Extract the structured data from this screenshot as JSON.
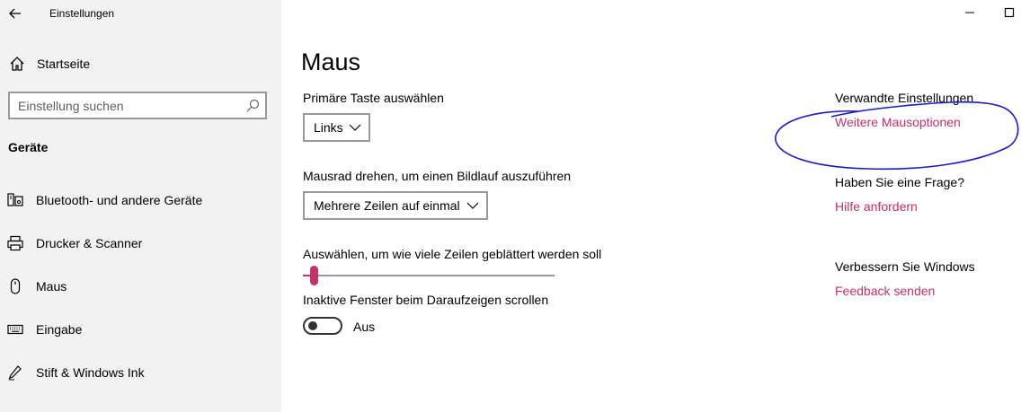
{
  "window": {
    "title": "Einstellungen",
    "back_icon": "arrow-left-icon",
    "minimize_icon": "minimize-icon",
    "maximize_icon": "maximize-icon"
  },
  "sidebar": {
    "home_label": "Startseite",
    "home_icon": "home-icon",
    "search_placeholder": "Einstellung suchen",
    "search_icon": "search-icon",
    "section_title": "Geräte",
    "items": [
      {
        "label": "Bluetooth- und andere Geräte",
        "icon": "bluetooth-devices-icon"
      },
      {
        "label": "Drucker & Scanner",
        "icon": "printer-icon"
      },
      {
        "label": "Maus",
        "icon": "mouse-icon"
      },
      {
        "label": "Eingabe",
        "icon": "keyboard-icon"
      },
      {
        "label": "Stift & Windows Ink",
        "icon": "pen-icon"
      }
    ]
  },
  "main": {
    "title": "Maus",
    "primary_button": {
      "label": "Primäre Taste auswählen",
      "value": "Links"
    },
    "wheel_scroll": {
      "label": "Mausrad drehen, um einen Bildlauf auszuführen",
      "value": "Mehrere Zeilen auf einmal"
    },
    "lines_slider": {
      "label": "Auswählen, um wie viele Zeilen geblättert werden soll",
      "value_fraction": 0.03
    },
    "inactive_scroll": {
      "label": "Inaktive Fenster beim Daraufzeigen scrollen",
      "state": "Aus"
    }
  },
  "related": {
    "heading": "Verwandte Einstellungen",
    "link": "Weitere Mausoptionen",
    "question_heading": "Haben Sie eine Frage?",
    "help_link": "Hilfe anfordern",
    "improve_heading": "Verbessern Sie Windows",
    "feedback_link": "Feedback senden"
  },
  "colors": {
    "accent": "#c7306a",
    "sidebar_bg": "#f2f2f2",
    "annotation": "#1a1ad0"
  }
}
